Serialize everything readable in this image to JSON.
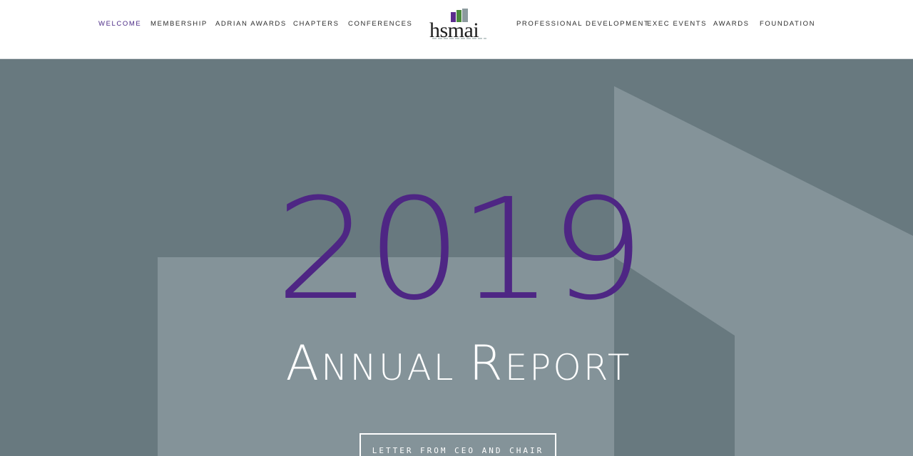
{
  "nav": {
    "left": [
      "WELCOME",
      "MEMBERSHIP",
      "ADRIAN AWARDS",
      "CHAPTERS",
      "CONFERENCES"
    ],
    "right": [
      "PROFESSIONAL DEVELOPMENT",
      "EXEC EVENTS",
      "AWARDS",
      "FOUNDATION"
    ],
    "active": "WELCOME"
  },
  "logo": {
    "text": "hsmai"
  },
  "hero": {
    "year": "2019",
    "subtitle_part1_big": "A",
    "subtitle_part1_small": "NNUAL ",
    "subtitle_part2_big": "R",
    "subtitle_part2_small": "EPORT",
    "cta_label": "LETTER FROM CEO AND CHAIR"
  },
  "colors": {
    "hero_bg": "#68797f",
    "hero_shape": "#849399",
    "year": "#4e2684",
    "active_nav": "#4b2a86"
  }
}
